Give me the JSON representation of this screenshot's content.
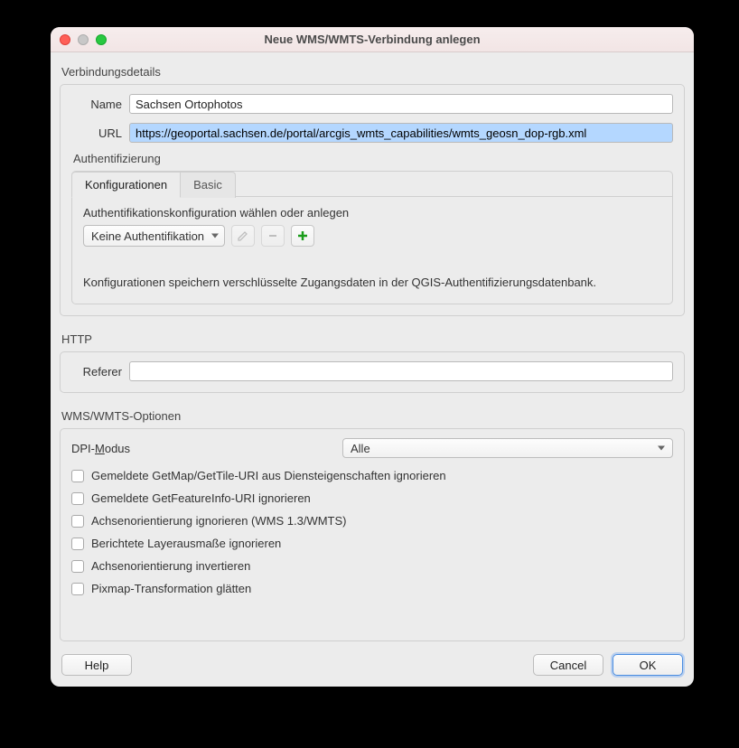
{
  "window": {
    "title": "Neue WMS/WMTS-Verbindung anlegen"
  },
  "conn": {
    "group": "Verbindungsdetails",
    "name_label": "Name",
    "name_value": "Sachsen Ortophotos",
    "url_label": "URL",
    "url_value": "https://geoportal.sachsen.de/portal/arcgis_wmts_capabilities/wmts_geosn_dop-rgb.xml"
  },
  "auth": {
    "label": "Authentifizierung",
    "tabs": {
      "config": "Konfigurationen",
      "basic": "Basic"
    },
    "prompt": "Authentifikationskonfiguration wählen oder anlegen",
    "combo_value": "Keine Authentifikation",
    "note": "Konfigurationen speichern verschlüsselte Zugangsdaten in der QGIS-Authentifizierungsdatenbank."
  },
  "http": {
    "group": "HTTP",
    "referer_label": "Referer",
    "referer_value": ""
  },
  "opts": {
    "group": "WMS/WMTS-Optionen",
    "dpi_label_pre": "DPI-",
    "dpi_label_m": "M",
    "dpi_label_post": "odus",
    "dpi_value": "Alle",
    "check1": "Gemeldete GetMap/GetTile-URI aus Diensteigenschaften ignorieren",
    "check2": "Gemeldete GetFeatureInfo-URI ignorieren",
    "check3": "Achsenorientierung ignorieren (WMS 1.3/WMTS)",
    "check4": "Berichtete Layerausmaße ignorieren",
    "check5": "Achsenorientierung invertieren",
    "check6": "Pixmap-Transformation glätten"
  },
  "buttons": {
    "help": "Help",
    "cancel": "Cancel",
    "ok": "OK"
  }
}
